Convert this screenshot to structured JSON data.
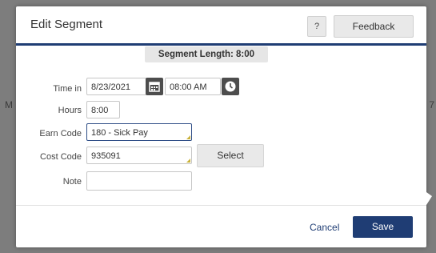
{
  "background": {
    "left_fragment": "M",
    "right_fragment": "7"
  },
  "dialog": {
    "title": "Edit Segment",
    "help_label": "?",
    "feedback_label": "Feedback",
    "segment_length": "Segment Length: 8:00"
  },
  "form": {
    "time_in": {
      "label": "Time in",
      "date": "8/23/2021",
      "time": "08:00 AM"
    },
    "hours": {
      "label": "Hours",
      "value": "8:00"
    },
    "earn_code": {
      "label": "Earn Code",
      "value": "180 - Sick Pay"
    },
    "cost_code": {
      "label": "Cost Code",
      "value": "935091",
      "select_label": "Select"
    },
    "note": {
      "label": "Note",
      "value": ""
    }
  },
  "footer": {
    "cancel_label": "Cancel",
    "save_label": "Save"
  },
  "colors": {
    "accent": "#1f3d74",
    "icon_button": "#4d4d4d"
  },
  "icons": [
    "calendar-icon",
    "clock-icon"
  ]
}
